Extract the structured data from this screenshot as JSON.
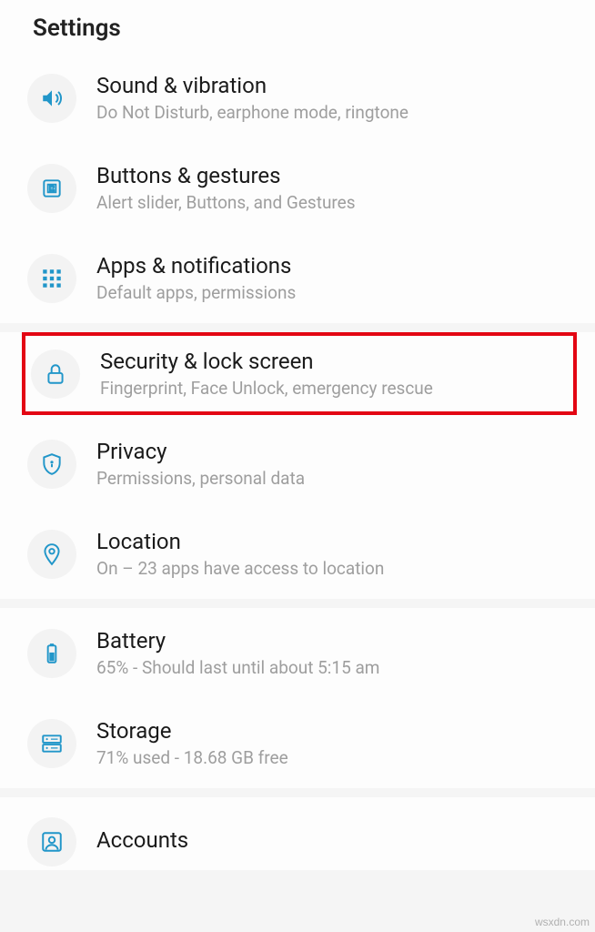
{
  "header": {
    "title": "Settings"
  },
  "items": [
    {
      "title": "Sound & vibration",
      "subtitle": "Do Not Disturb, earphone mode, ringtone"
    },
    {
      "title": "Buttons & gestures",
      "subtitle": "Alert slider, Buttons, and Gestures"
    },
    {
      "title": "Apps & notifications",
      "subtitle": "Default apps, permissions"
    },
    {
      "title": "Security & lock screen",
      "subtitle": "Fingerprint, Face Unlock, emergency rescue"
    },
    {
      "title": "Privacy",
      "subtitle": "Permissions, personal data"
    },
    {
      "title": "Location",
      "subtitle": "On – 23 apps have access to location"
    },
    {
      "title": "Battery",
      "subtitle": "65% - Should last until about 5:15 am"
    },
    {
      "title": "Storage",
      "subtitle": "71% used - 18.68 GB free"
    },
    {
      "title": "Accounts",
      "subtitle": ""
    }
  ],
  "watermark": "wsxdn.com",
  "colors": {
    "iconBlue": "#2196c9",
    "highlightRed": "#e30613"
  }
}
